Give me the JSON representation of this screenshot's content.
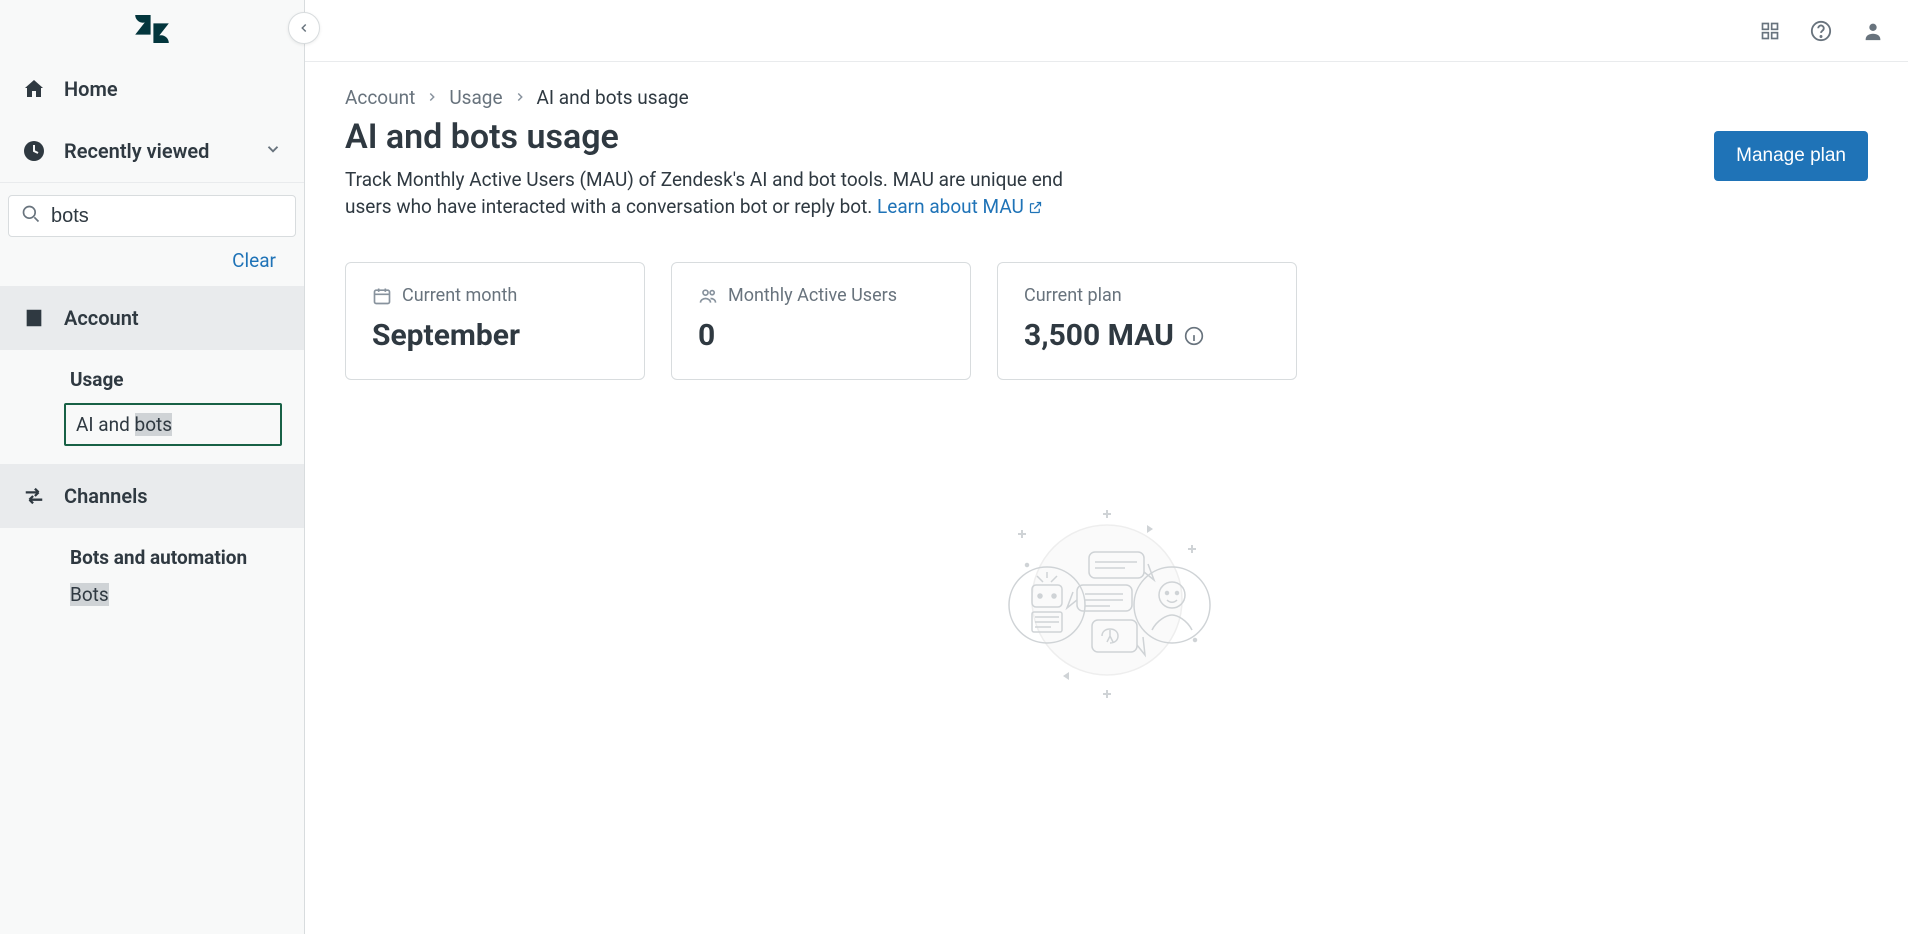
{
  "sidebar": {
    "home_label": "Home",
    "recent_label": "Recently viewed",
    "search_value": "bots",
    "clear_label": "Clear",
    "account": {
      "label": "Account",
      "usage_group": "Usage",
      "ai_bots_prefix": "AI and ",
      "ai_bots_highlight": "bots"
    },
    "channels": {
      "label": "Channels",
      "group": "Bots and automation",
      "bots_item": "Bots"
    }
  },
  "breadcrumb": {
    "account": "Account",
    "usage": "Usage",
    "current": "AI and bots usage"
  },
  "page": {
    "title": "AI and bots usage",
    "description": "Track Monthly Active Users (MAU) of Zendesk's AI and bot tools. MAU are unique end users who have interacted with a conversation bot or reply bot. ",
    "learn_link": "Learn about MAU",
    "manage_plan": "Manage plan"
  },
  "cards": {
    "current_month_label": "Current month",
    "current_month_value": "September",
    "mau_label": "Monthly Active Users",
    "mau_value": "0",
    "plan_label": "Current plan",
    "plan_value": "3,500 MAU"
  }
}
